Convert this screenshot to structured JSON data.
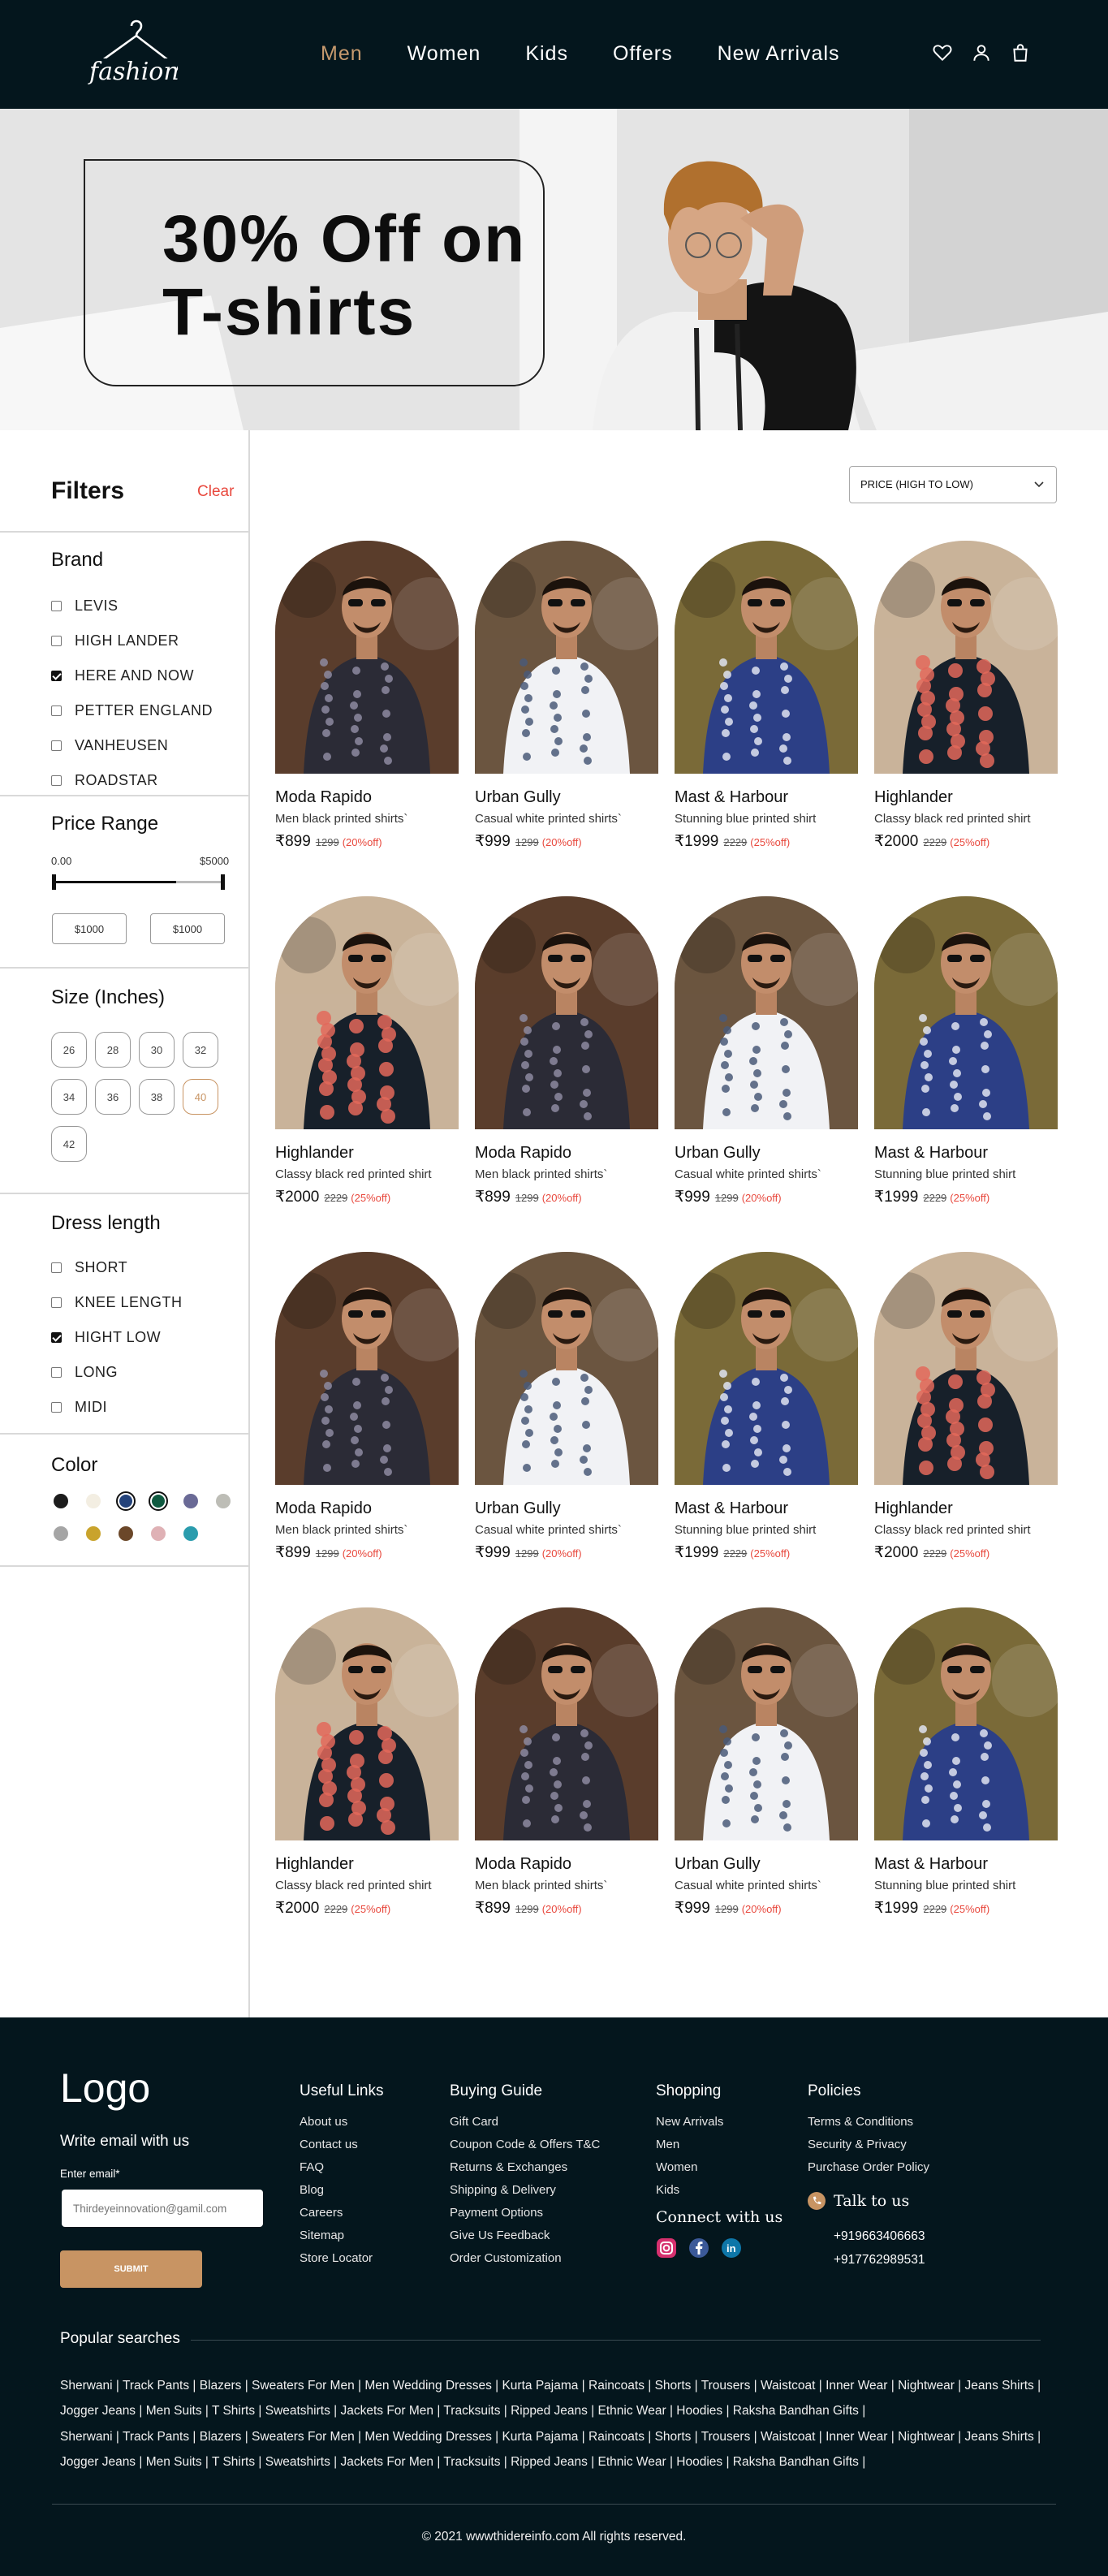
{
  "header": {
    "logo_text": "fashion",
    "nav": [
      "Men",
      "Women",
      "Kids",
      "Offers",
      "New Arrivals"
    ],
    "active_nav": "Men",
    "icons": [
      "heart-icon",
      "user-icon",
      "bag-icon"
    ]
  },
  "banner": {
    "line1": "30% Off on",
    "line2": "T-shirts"
  },
  "filters": {
    "title": "Filters",
    "clear": "Clear",
    "brand": {
      "title": "Brand",
      "items": [
        {
          "label": "LEVIS",
          "checked": false
        },
        {
          "label": "HIGH LANDER",
          "checked": false
        },
        {
          "label": "HERE AND NOW",
          "checked": true
        },
        {
          "label": "PETTER ENGLAND",
          "checked": false
        },
        {
          "label": "VANHEUSEN",
          "checked": false
        },
        {
          "label": "ROADSTAR",
          "checked": false
        }
      ]
    },
    "price": {
      "title": "Price Range",
      "min_label": "0.00",
      "max_label": "$5000",
      "min_input": "$1000",
      "max_input": "$1000"
    },
    "size": {
      "title": "Size (Inches)",
      "options": [
        "26",
        "28",
        "30",
        "32",
        "34",
        "36",
        "38",
        "40",
        "42"
      ],
      "selected": "40"
    },
    "dress_length": {
      "title": "Dress length",
      "items": [
        {
          "label": "SHORT",
          "checked": false
        },
        {
          "label": "KNEE LENGTH",
          "checked": false
        },
        {
          "label": "HIGHT LOW",
          "checked": true
        },
        {
          "label": "LONG",
          "checked": false
        },
        {
          "label": "MIDI",
          "checked": false
        }
      ]
    },
    "color": {
      "title": "Color",
      "swatches": [
        "#1c1c1c",
        "#f3eee2",
        "#23427a",
        "#0f5a40",
        "#6a6a96",
        "#bdbdb6",
        "#a5a5a5",
        "#c9a32c",
        "#6b4729",
        "#dfb1b5",
        "#2a9cad"
      ],
      "selected": [
        "#23427a",
        "#0f5a40"
      ]
    }
  },
  "sort": {
    "label": "PRICE (HIGH TO LOW)"
  },
  "products": [
    {
      "name": "Moda Rapido",
      "desc": "Men black printed shirts`",
      "price": "₹899",
      "old": "1299",
      "off": "(20%off)",
      "img": "black"
    },
    {
      "name": "Urban Gully",
      "desc": "Casual white printed shirts`",
      "price": "₹999",
      "old": "1299",
      "off": "(20%off)",
      "img": "white"
    },
    {
      "name": "Mast & Harbour",
      "desc": "Stunning blue printed shirt",
      "price": "₹1999",
      "old": "2229",
      "off": "(25%off)",
      "img": "blue"
    },
    {
      "name": "Highlander",
      "desc": "Classy black red printed shirt",
      "price": "₹2000",
      "old": "2229",
      "off": "(25%off)",
      "img": "floral"
    },
    {
      "name": "Highlander",
      "desc": "Classy black red printed shirt",
      "price": "₹2000",
      "old": "2229",
      "off": "(25%off)",
      "img": "floral"
    },
    {
      "name": "Moda Rapido",
      "desc": "Men black printed shirts`",
      "price": "₹899",
      "old": "1299",
      "off": "(20%off)",
      "img": "black"
    },
    {
      "name": "Urban Gully",
      "desc": "Casual white printed shirts`",
      "price": "₹999",
      "old": "1299",
      "off": "(20%off)",
      "img": "white"
    },
    {
      "name": "Mast & Harbour",
      "desc": "Stunning blue printed shirt",
      "price": "₹1999",
      "old": "2229",
      "off": "(25%off)",
      "img": "blue"
    },
    {
      "name": "Moda Rapido",
      "desc": "Men black printed shirts`",
      "price": "₹899",
      "old": "1299",
      "off": "(20%off)",
      "img": "black"
    },
    {
      "name": "Urban Gully",
      "desc": "Casual white printed shirts`",
      "price": "₹999",
      "old": "1299",
      "off": "(20%off)",
      "img": "white"
    },
    {
      "name": "Mast & Harbour",
      "desc": "Stunning blue printed shirt",
      "price": "₹1999",
      "old": "2229",
      "off": "(25%off)",
      "img": "blue"
    },
    {
      "name": "Highlander",
      "desc": "Classy black red printed shirt",
      "price": "₹2000",
      "old": "2229",
      "off": "(25%off)",
      "img": "floral"
    },
    {
      "name": "Highlander",
      "desc": "Classy black red printed shirt",
      "price": "₹2000",
      "old": "2229",
      "off": "(25%off)",
      "img": "floral"
    },
    {
      "name": "Moda Rapido",
      "desc": "Men black printed shirts`",
      "price": "₹899",
      "old": "1299",
      "off": "(20%off)",
      "img": "black"
    },
    {
      "name": "Urban Gully",
      "desc": "Casual white printed shirts`",
      "price": "₹999",
      "old": "1299",
      "off": "(20%off)",
      "img": "white"
    },
    {
      "name": "Mast & Harbour",
      "desc": "Stunning blue printed shirt",
      "price": "₹1999",
      "old": "2229",
      "off": "(25%off)",
      "img": "blue"
    }
  ],
  "footer": {
    "logo": "Logo",
    "email_title": "Write email with us",
    "email_label": "Enter email*",
    "email_placeholder": "Thirdeyeinnovation@gamil.com",
    "submit": "SUBMIT",
    "useful": {
      "title": "Useful Links",
      "links": [
        "About us",
        "Contact us",
        "FAQ",
        "Blog",
        "Careers",
        "Sitemap",
        "Store Locator"
      ]
    },
    "buying": {
      "title": "Buying Guide",
      "links": [
        "Gift Card",
        "Coupon Code & Offers T&C",
        "Returns & Exchanges",
        "Shipping & Delivery",
        "Payment Options",
        "Give Us Feedback",
        "Order Customization"
      ]
    },
    "shopping": {
      "title": "Shopping",
      "links": [
        "New Arrivals",
        "Men",
        "Women",
        "Kids"
      ]
    },
    "connect": "Connect with us",
    "policies": {
      "title": "Policies",
      "links": [
        "Terms & Conditions",
        "Security & Privacy",
        "Purchase Order Policy"
      ]
    },
    "talk": "Talk to us",
    "phones": [
      "+919663406663",
      "+917762989531"
    ],
    "popular_title": "Popular searches",
    "popular_text": "Sherwani | Track Pants | Blazers | Sweaters For Men | Men Wedding Dresses | Kurta Pajama | Raincoats | Shorts | Trousers | Waistcoat | Inner Wear | Nightwear | Jeans Shirts | Jogger Jeans | Men Suits | T Shirts | Sweatshirts | Jackets For Men | Tracksuits | Ripped Jeans | Ethnic Wear | Hoodies | Raksha Bandhan Gifts |",
    "copyright": "© 2021 wwwthidereinfo.com All rights reserved."
  }
}
